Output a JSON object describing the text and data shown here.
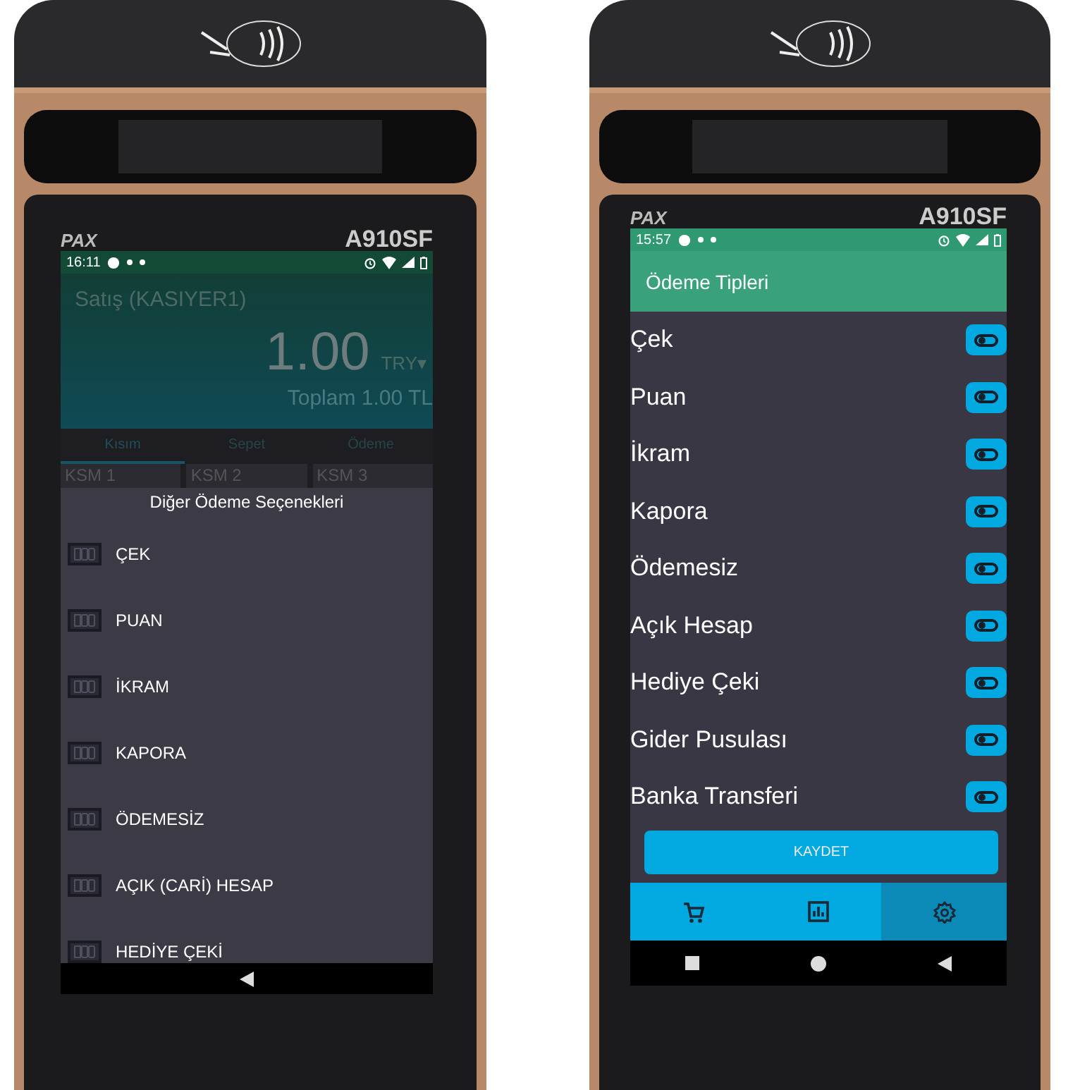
{
  "devices": [
    {
      "brand": "PAX",
      "model": "A910SF",
      "screen": {
        "kind": "sale_dialog",
        "time": "16:11",
        "title": "Satış (KASIYER1)",
        "amount": "1.00",
        "currency": "TRY▾",
        "total": "Toplam 1.00 TL",
        "tabs": [
          {
            "label": "Kısım",
            "selected": true
          },
          {
            "label": "Sepet",
            "selected": false
          },
          {
            "label": "Ödeme",
            "selected": false
          }
        ],
        "sections": [
          "KSM 1",
          "KSM 2",
          "KSM 3"
        ],
        "dialog": {
          "title": "Diğer Ödeme Seçenekleri",
          "options": [
            "ÇEK",
            "PUAN",
            "İKRAM",
            "KAPORA",
            "ÖDEMESİZ",
            "AÇIK (CARİ) HESAP",
            "HEDİYE ÇEKİ"
          ]
        }
      }
    },
    {
      "brand": "PAX",
      "model": "A910SF",
      "screen": {
        "kind": "payment_types",
        "time": "15:57",
        "title": "Ödeme Tipleri",
        "types": [
          {
            "label": "Çek",
            "on": false
          },
          {
            "label": "Puan",
            "on": false
          },
          {
            "label": "İkram",
            "on": false
          },
          {
            "label": "Kapora",
            "on": false
          },
          {
            "label": "Ödemesiz",
            "on": false
          },
          {
            "label": "Açık Hesap",
            "on": false
          },
          {
            "label": "Hediye Çeki",
            "on": false
          },
          {
            "label": "Gider Pusulası",
            "on": false
          },
          {
            "label": "Banka Transferi",
            "on": false
          }
        ],
        "save_button": "KAYDET",
        "nav": [
          {
            "kind": "cart",
            "selected": false
          },
          {
            "kind": "chart",
            "selected": false
          },
          {
            "kind": "settings",
            "selected": true
          }
        ]
      }
    }
  ]
}
